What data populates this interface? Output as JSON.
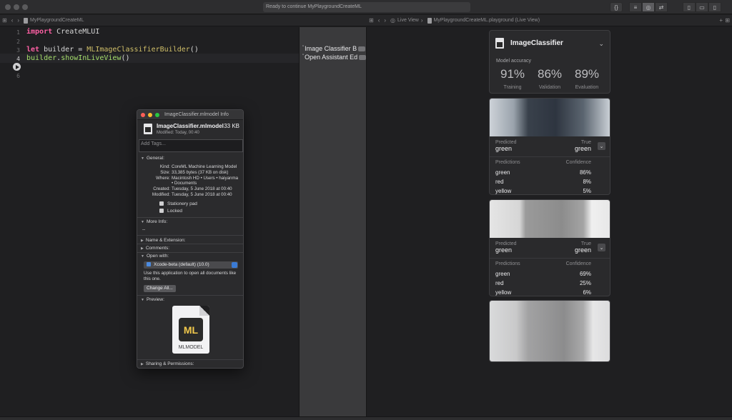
{
  "window": {
    "status": "Ready to continue MyPlaygroundCreateML"
  },
  "editor_jumpbar": {
    "file": "MyPlaygroundCreateML"
  },
  "live_jumpbar": {
    "live_view": "Live View",
    "file": "MyPlaygroundCreateML.playground (Live View)"
  },
  "code": {
    "line_numbers": [
      "1",
      "2",
      "3",
      "4",
      "6"
    ],
    "line1_kw": "import",
    "line1_rest": " CreateMLUI",
    "line3_kw": "let",
    "line3_mid": " builder = ",
    "line3_type": "MLImageClassifierBuilder",
    "line3_end": "()",
    "line4_obj": "builder",
    "line4_dot": ".",
    "line4_fn": "showInLiveView",
    "line4_end": "()"
  },
  "results": {
    "row1": "Image Classifier B",
    "row2": "Open Assistant Ed"
  },
  "classifier": {
    "title": "ImageClassifier",
    "accuracy_label": "Model accuracy",
    "metrics": [
      {
        "value": "91%",
        "name": "Training"
      },
      {
        "value": "86%",
        "name": "Validation"
      },
      {
        "value": "89%",
        "name": "Evaluation"
      }
    ]
  },
  "samples": [
    {
      "predicted_label": "Predicted",
      "predicted_value": "green",
      "true_label": "True",
      "true_value": "green",
      "pred_header": "Predictions",
      "conf_header": "Confidence",
      "rows": [
        {
          "label": "green",
          "conf": "86%"
        },
        {
          "label": "red",
          "conf": "8%"
        },
        {
          "label": "yellow",
          "conf": "5%"
        }
      ]
    },
    {
      "predicted_label": "Predicted",
      "predicted_value": "green",
      "true_label": "True",
      "true_value": "green",
      "pred_header": "Predictions",
      "conf_header": "Confidence",
      "rows": [
        {
          "label": "green",
          "conf": "69%"
        },
        {
          "label": "red",
          "conf": "25%"
        },
        {
          "label": "yellow",
          "conf": "6%"
        }
      ]
    }
  ],
  "info": {
    "title": "ImageClassifier.mlmodel Info",
    "file_name": "ImageClassifier.mlmodel",
    "file_size": "33 KB",
    "modified_short": "Modified: Today, 00:40",
    "tags_placeholder": "Add Tags...",
    "general": "General:",
    "kind_k": "Kind:",
    "kind_v": "CoreML Machine Learning Model",
    "size_k": "Size:",
    "size_v": "33,385 bytes (37 KB on disk)",
    "where_k": "Where:",
    "where_v1": "Macintosh HD • Users • haiyanma",
    "where_v2": "• Documents",
    "created_k": "Created:",
    "created_v": "Tuesday, 5 June 2018 at 00:40",
    "modified_k": "Modified:",
    "modified_v": "Tuesday, 5 June 2018 at 00:40",
    "stationery": "Stationery pad",
    "locked": "Locked",
    "more_info": "More Info:",
    "more_info_value": "--",
    "name_ext": "Name & Extension:",
    "comments": "Comments:",
    "open_with": "Open with:",
    "app": "Xcode-beta (default) (10.0)",
    "use_app": "Use this application to open all documents like this one.",
    "change_all": "Change All...",
    "preview": "Preview:",
    "badge": "ML",
    "caption": "MLMODEL",
    "sharing": "Sharing & Permissions:"
  }
}
